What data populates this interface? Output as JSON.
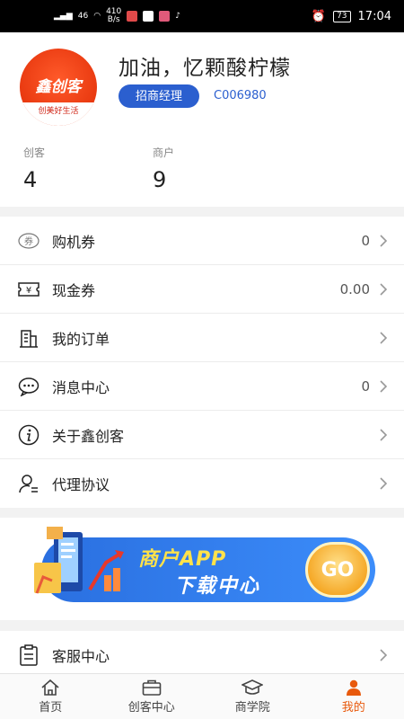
{
  "status_bar": {
    "network": "46",
    "speed_value": "410",
    "speed_unit": "B/s",
    "battery": "73",
    "time": "17:04"
  },
  "profile": {
    "logo_text": "鑫创客",
    "logo_slogan": "创美好生活",
    "name": "加油，忆颗酸柠檬",
    "role": "招商经理",
    "code": "C006980",
    "stats": [
      {
        "label": "创客",
        "value": "4"
      },
      {
        "label": "商户",
        "value": "9"
      }
    ]
  },
  "menu": [
    {
      "icon": "coupon-icon",
      "icon_text": "券",
      "label": "购机券",
      "value": "0"
    },
    {
      "icon": "cash-ticket-icon",
      "icon_text": "¥",
      "label": "现金券",
      "value": "0.00"
    },
    {
      "icon": "building-icon",
      "label": "我的订单",
      "value": ""
    },
    {
      "icon": "chat-icon",
      "label": "消息中心",
      "value": "0"
    },
    {
      "icon": "info-icon",
      "label": "关于鑫创客",
      "value": ""
    },
    {
      "icon": "user-doc-icon",
      "label": "代理协议",
      "value": ""
    }
  ],
  "banner": {
    "line1": "商户APP",
    "line2": "下载中心",
    "go": "GO"
  },
  "menu2": [
    {
      "icon": "clipboard-icon",
      "label": "客服中心",
      "value": ""
    }
  ],
  "tabs": [
    {
      "label": "首页",
      "icon": "home-icon"
    },
    {
      "label": "创客中心",
      "icon": "briefcase-icon"
    },
    {
      "label": "商学院",
      "icon": "graduation-cap-icon"
    },
    {
      "label": "我的",
      "icon": "person-icon",
      "active": true
    }
  ],
  "colors": {
    "accent": "#2b5fcf",
    "active_tab": "#e8590c",
    "brand": "#e8380f"
  }
}
